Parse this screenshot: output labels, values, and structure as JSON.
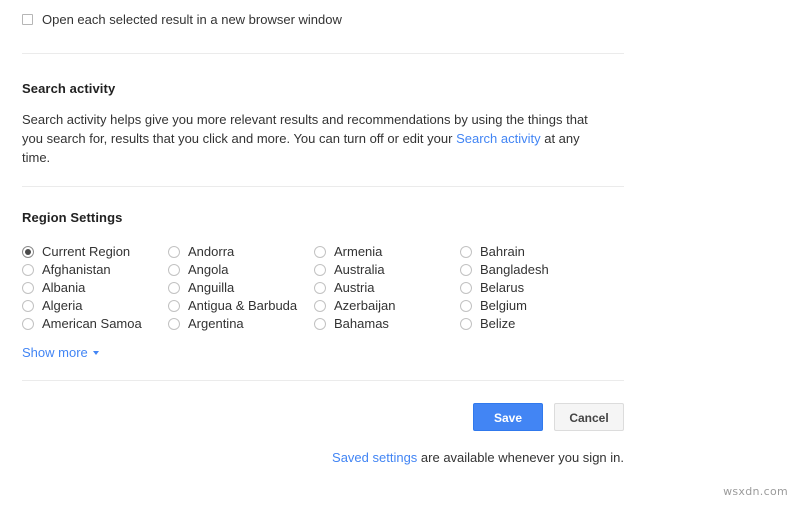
{
  "colors": {
    "link": "#4285f4",
    "save_button_bg": "#4285f4",
    "cancel_button_bg": "#f5f5f5",
    "divider": "#ebebeb",
    "text": "#333333"
  },
  "new_window_option": {
    "label": "Open each selected result in a new browser window",
    "checked": false
  },
  "search_activity": {
    "heading": "Search activity",
    "paragraph_part1": "Search activity helps give you more relevant results and recommendations by using the things that you search for, results that you click and more. You can turn off or edit your ",
    "link_text": "Search activity",
    "paragraph_part2": " at any time."
  },
  "region_settings": {
    "heading": "Region Settings",
    "selected": "Current Region",
    "columns": [
      [
        "Current Region",
        "Afghanistan",
        "Albania",
        "Algeria",
        "American Samoa"
      ],
      [
        "Andorra",
        "Angola",
        "Anguilla",
        "Antigua & Barbuda",
        "Argentina"
      ],
      [
        "Armenia",
        "Australia",
        "Austria",
        "Azerbaijan",
        "Bahamas"
      ],
      [
        "Bahrain",
        "Bangladesh",
        "Belarus",
        "Belgium",
        "Belize"
      ]
    ],
    "show_more_label": "Show more"
  },
  "actions": {
    "save_label": "Save",
    "cancel_label": "Cancel"
  },
  "footer": {
    "link_text": "Saved settings",
    "rest_text": " are available whenever you sign in."
  },
  "watermark": "wsxdn.com"
}
